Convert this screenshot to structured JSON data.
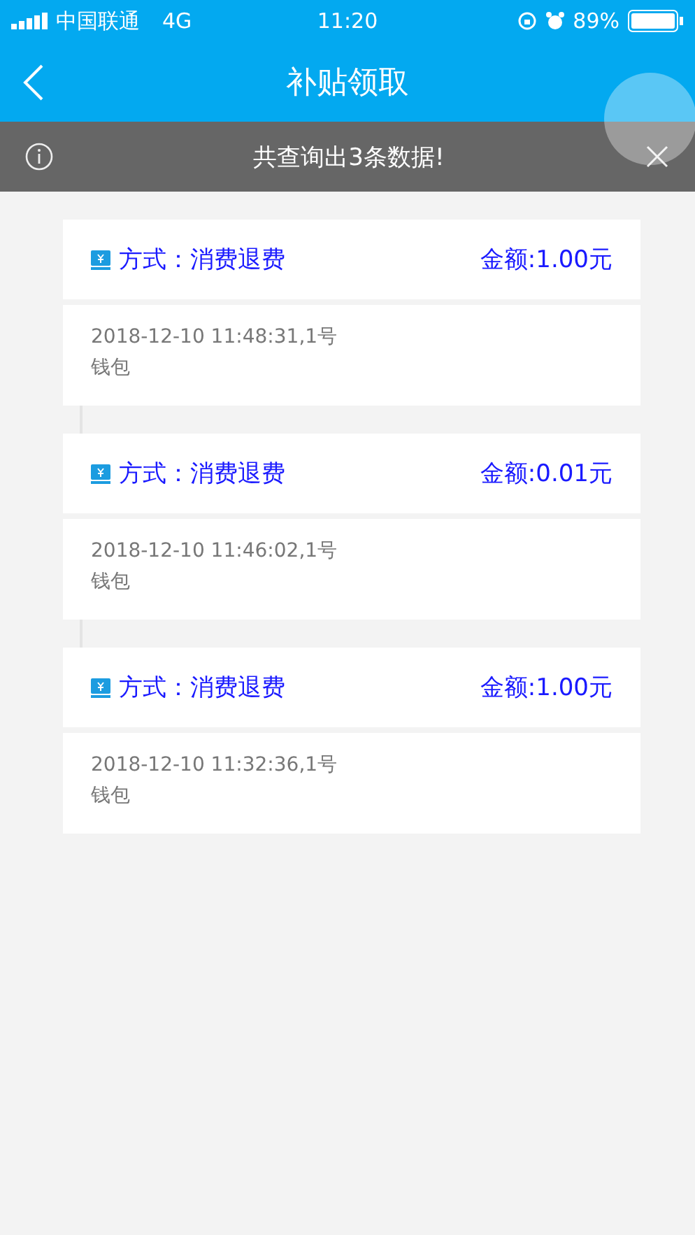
{
  "status_bar": {
    "carrier": "中国联通",
    "network": "4G",
    "time": "11:20",
    "battery": "89%"
  },
  "nav": {
    "title": "补贴领取"
  },
  "notice": {
    "text": "共查询出3条数据!"
  },
  "records": [
    {
      "method": "方式：消费退费",
      "amount": "金额:1.00元",
      "time": "2018-12-10 11:48:31,1号",
      "account": "钱包"
    },
    {
      "method": "方式：消费退费",
      "amount": "金额:0.01元",
      "time": "2018-12-10 11:46:02,1号",
      "account": "钱包"
    },
    {
      "method": "方式：消费退费",
      "amount": "金额:1.00元",
      "time": "2018-12-10 11:32:36,1号",
      "account": "钱包"
    }
  ]
}
